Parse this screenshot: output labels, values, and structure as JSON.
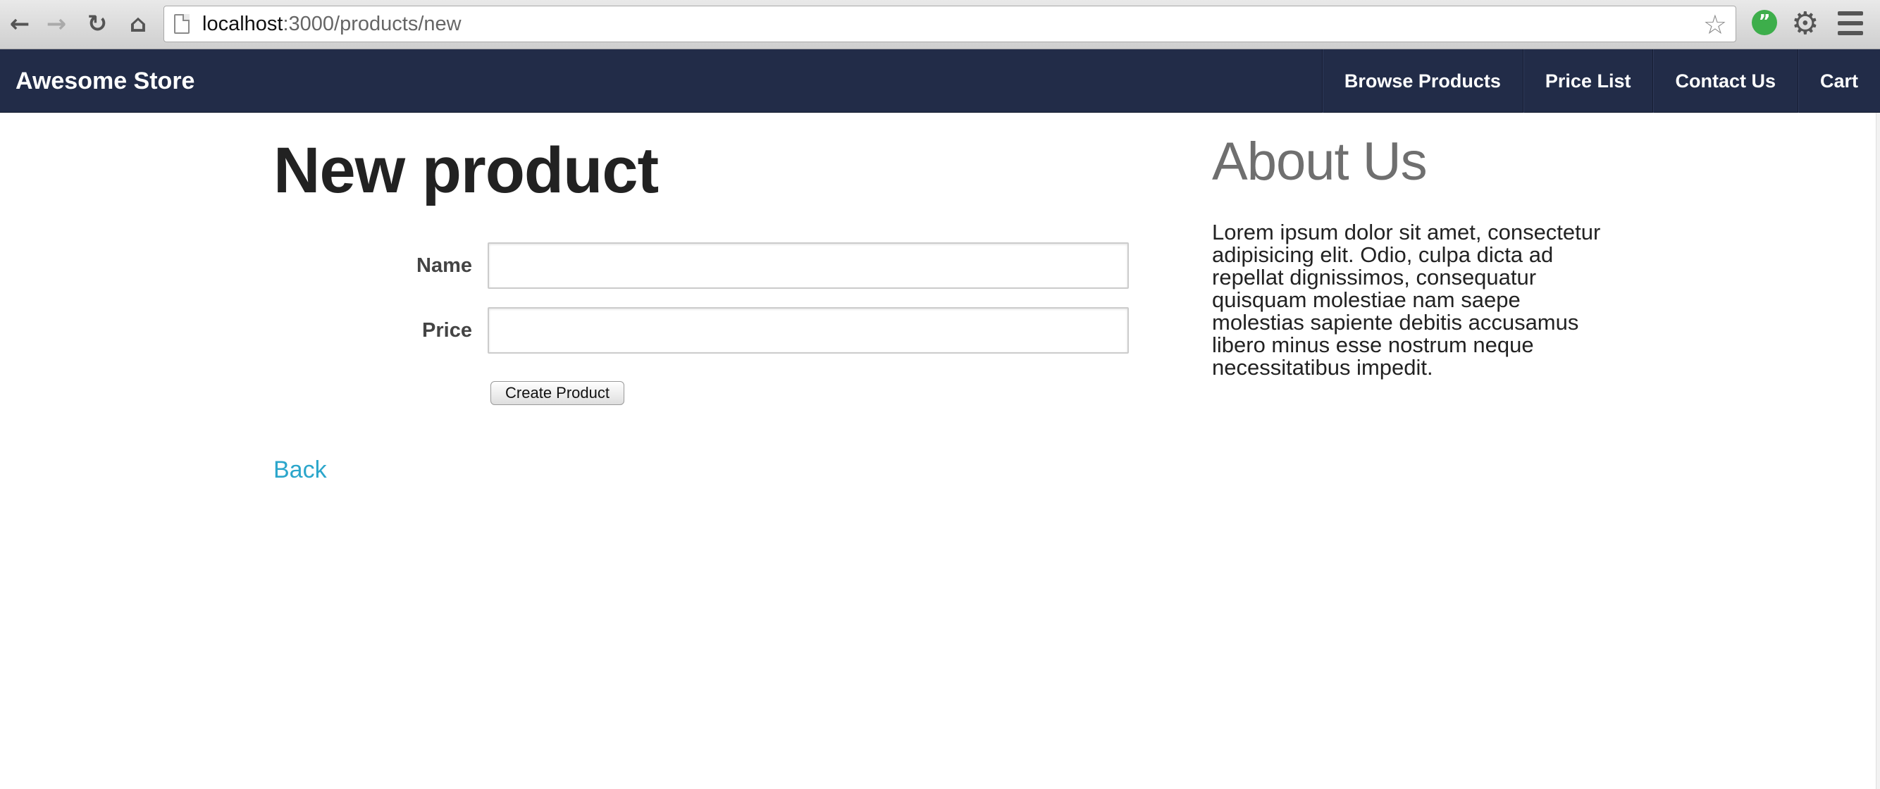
{
  "browser": {
    "url_host": "localhost",
    "url_path": ":3000/products/new",
    "back_icon": "back-arrow-icon",
    "forward_icon": "forward-arrow-icon",
    "reload_icon": "reload-icon",
    "home_icon": "home-icon",
    "star_icon": "bookmark-star-icon"
  },
  "navbar": {
    "brand": "Awesome Store",
    "links": [
      {
        "label": "Browse Products"
      },
      {
        "label": "Price List"
      },
      {
        "label": "Contact Us"
      },
      {
        "label": "Cart"
      }
    ],
    "background": "#222c48"
  },
  "main": {
    "title": "New product",
    "form": {
      "name_label": "Name",
      "name_value": "",
      "price_label": "Price",
      "price_value": "",
      "submit_label": "Create Product"
    },
    "back_link": "Back",
    "link_color": "#2ba6cb"
  },
  "sidebar": {
    "title": "About Us",
    "text": "Lorem ipsum dolor sit amet, consectetur adipisicing elit. Odio, culpa dicta ad repellat dignissimos, consequatur quisquam molestiae nam saepe molestias sapiente debitis accusamus libero minus esse nostrum neque necessitatibus impedit."
  }
}
